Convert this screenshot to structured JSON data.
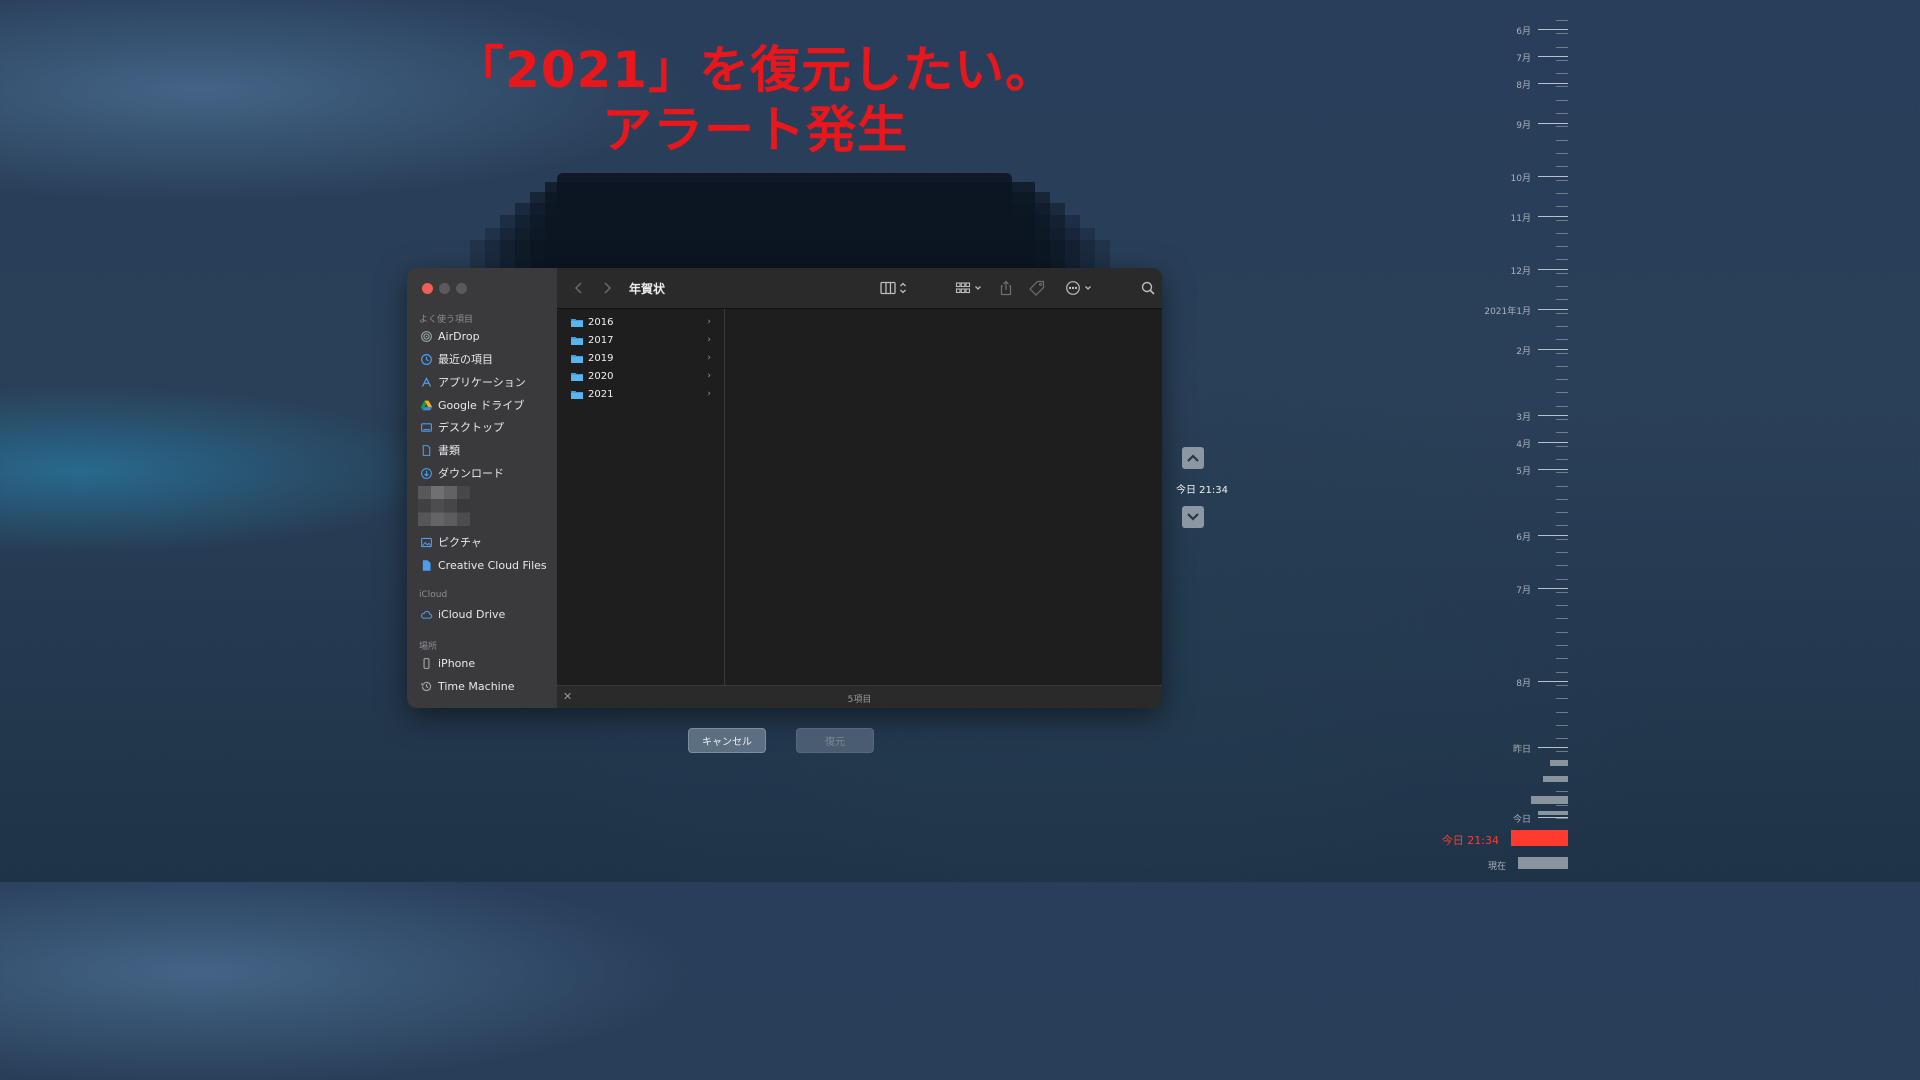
{
  "annotation": {
    "line1": "「2021」を復元したい。",
    "line2": "アラート発生",
    "color": "#e8171b"
  },
  "window": {
    "title": "年賀状",
    "sidebar": {
      "sections": {
        "favorites": "よく使う項目",
        "icloud": "iCloud",
        "locations": "場所"
      },
      "favorites": [
        {
          "label": "AirDrop",
          "icon": "airdrop-icon"
        },
        {
          "label": "最近の項目",
          "icon": "clock-icon"
        },
        {
          "label": "アプリケーション",
          "icon": "applications-icon"
        },
        {
          "label": "Google ドライブ",
          "icon": "google-drive-icon"
        },
        {
          "label": "デスクトップ",
          "icon": "desktop-icon"
        },
        {
          "label": "書類",
          "icon": "document-icon"
        },
        {
          "label": "ダウンロード",
          "icon": "download-icon"
        },
        {
          "label": "ピクチャ",
          "icon": "pictures-icon"
        },
        {
          "label": "Creative Cloud Files",
          "icon": "file-icon"
        }
      ],
      "icloud": [
        {
          "label": "iCloud Drive",
          "icon": "cloud-icon"
        }
      ],
      "locations": [
        {
          "label": "iPhone",
          "icon": "phone-icon"
        },
        {
          "label": "Time Machine",
          "icon": "time-machine-icon"
        }
      ]
    },
    "folders": [
      "2016",
      "2017",
      "2019",
      "2020",
      "2021"
    ],
    "status": "5項目"
  },
  "buttons": {
    "cancel": "キャンセル",
    "restore": "復元"
  },
  "navigation": {
    "current_time": "今日 21:34"
  },
  "timeline": {
    "labels": [
      "6月",
      "7月",
      "8月",
      "9月",
      "10月",
      "11月",
      "12月",
      "2021年1月",
      "2月",
      "3月",
      "4月",
      "5月",
      "6月",
      "7月",
      "8月",
      "昨日",
      "今日"
    ],
    "current": "今日 21:34",
    "now": "現在",
    "accent": "#ff3b30"
  }
}
